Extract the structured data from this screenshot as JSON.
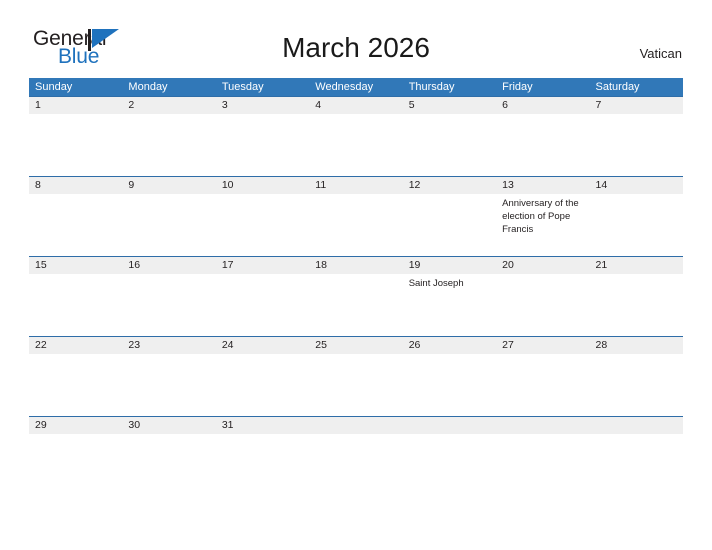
{
  "brand": {
    "name_part1": "General",
    "name_part2": "Blue",
    "flag_icon": "triangle-flag-icon",
    "accent_color": "#1f72bd"
  },
  "header": {
    "title": "March 2026",
    "region": "Vatican"
  },
  "calendar": {
    "header_background": "#3178b8",
    "day_band_background": "#efefef",
    "weekdays": [
      "Sunday",
      "Monday",
      "Tuesday",
      "Wednesday",
      "Thursday",
      "Friday",
      "Saturday"
    ],
    "weeks": [
      {
        "days": [
          {
            "number": "1",
            "events": []
          },
          {
            "number": "2",
            "events": []
          },
          {
            "number": "3",
            "events": []
          },
          {
            "number": "4",
            "events": []
          },
          {
            "number": "5",
            "events": []
          },
          {
            "number": "6",
            "events": []
          },
          {
            "number": "7",
            "events": []
          }
        ]
      },
      {
        "days": [
          {
            "number": "8",
            "events": []
          },
          {
            "number": "9",
            "events": []
          },
          {
            "number": "10",
            "events": []
          },
          {
            "number": "11",
            "events": []
          },
          {
            "number": "12",
            "events": []
          },
          {
            "number": "13",
            "events": [
              "Anniversary of the election of Pope Francis"
            ]
          },
          {
            "number": "14",
            "events": []
          }
        ]
      },
      {
        "days": [
          {
            "number": "15",
            "events": []
          },
          {
            "number": "16",
            "events": []
          },
          {
            "number": "17",
            "events": []
          },
          {
            "number": "18",
            "events": []
          },
          {
            "number": "19",
            "events": [
              "Saint Joseph"
            ]
          },
          {
            "number": "20",
            "events": []
          },
          {
            "number": "21",
            "events": []
          }
        ]
      },
      {
        "days": [
          {
            "number": "22",
            "events": []
          },
          {
            "number": "23",
            "events": []
          },
          {
            "number": "24",
            "events": []
          },
          {
            "number": "25",
            "events": []
          },
          {
            "number": "26",
            "events": []
          },
          {
            "number": "27",
            "events": []
          },
          {
            "number": "28",
            "events": []
          }
        ]
      },
      {
        "days": [
          {
            "number": "29",
            "events": []
          },
          {
            "number": "30",
            "events": []
          },
          {
            "number": "31",
            "events": []
          },
          {
            "number": "",
            "events": []
          },
          {
            "number": "",
            "events": []
          },
          {
            "number": "",
            "events": []
          },
          {
            "number": "",
            "events": []
          }
        ]
      }
    ]
  }
}
